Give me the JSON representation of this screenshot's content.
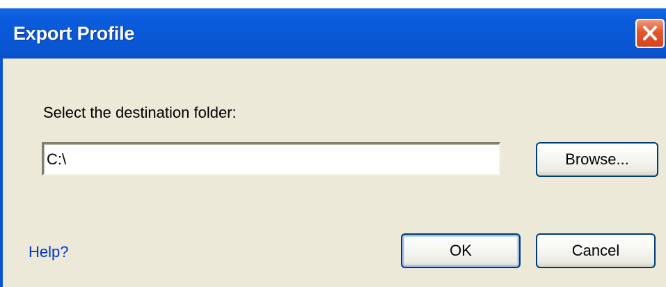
{
  "window": {
    "title": "Export Profile"
  },
  "content": {
    "prompt": "Select the destination folder:",
    "path_value": "C:\\"
  },
  "buttons": {
    "browse": "Browse...",
    "ok": "OK",
    "cancel": "Cancel"
  },
  "links": {
    "help": "Help?"
  },
  "colors": {
    "titlebar": "#0a58d6",
    "close_button": "#e2562d",
    "dialog_background": "#ece9d8",
    "link": "#0033cc",
    "button_border": "#003c74"
  },
  "icons": {
    "close": "close-x-icon"
  }
}
